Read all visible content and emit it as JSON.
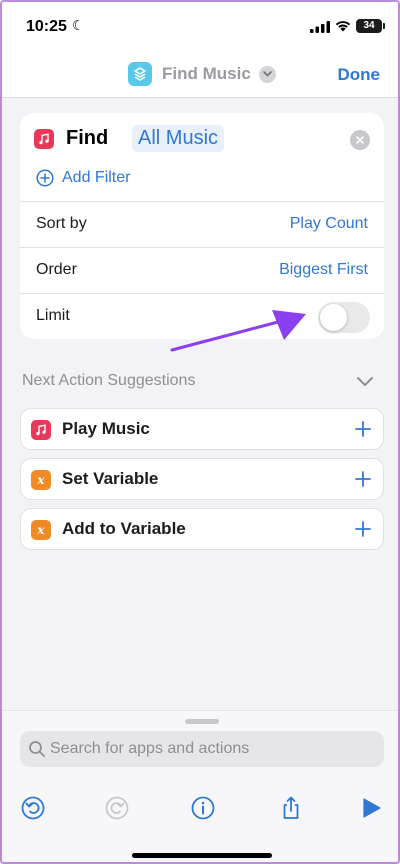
{
  "status_bar": {
    "time": "10:25",
    "battery": "34"
  },
  "navbar": {
    "title": "Find Music",
    "done_label": "Done"
  },
  "action": {
    "verb": "Find",
    "source": "All Music",
    "add_filter_label": "Add Filter",
    "rows": [
      {
        "label": "Sort by",
        "value": "Play Count"
      },
      {
        "label": "Order",
        "value": "Biggest First"
      },
      {
        "label": "Limit",
        "toggle_on": false
      }
    ]
  },
  "suggestions": {
    "title": "Next Action Suggestions",
    "items": [
      {
        "label": "Play Music",
        "icon": "music-note-icon",
        "color": "#e8395a"
      },
      {
        "label": "Set Variable",
        "icon": "variable-icon",
        "color": "#f08a24"
      },
      {
        "label": "Add to Variable",
        "icon": "variable-icon",
        "color": "#f08a24"
      }
    ]
  },
  "search": {
    "placeholder": "Search for apps and actions"
  },
  "colors": {
    "accent": "#2f78d4",
    "annotation_arrow": "#8a3ff0",
    "music": "#e8395a",
    "variable": "#f08a24"
  }
}
